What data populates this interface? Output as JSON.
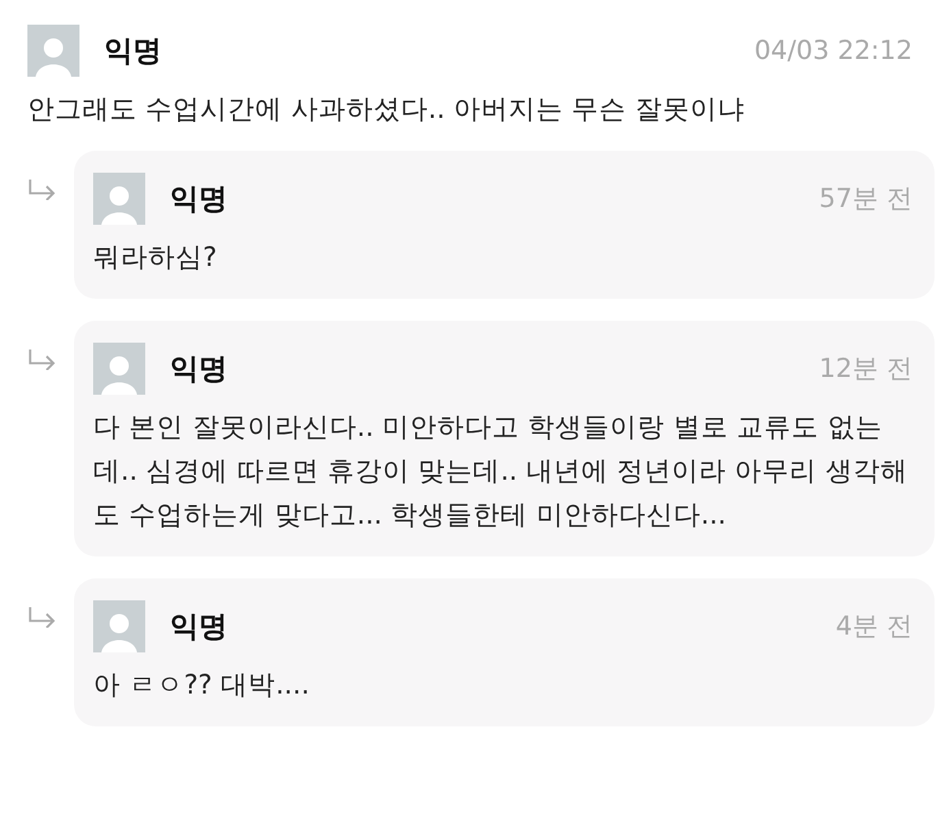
{
  "comment": {
    "author": "익명",
    "time": "04/03 22:12",
    "text": "안그래도 수업시간에 사과하셨다.. 아버지는 무슨 잘못이냐"
  },
  "replies": [
    {
      "author": "익명",
      "time": "57분 전",
      "text": "뭐라하심?"
    },
    {
      "author": "익명",
      "time": "12분 전",
      "text": "다 본인 잘못이라신다.. 미안하다고 학생들이랑 별로 교류도 없는데.. 심경에 따르면 휴강이 맞는데.. 내년에 정년이라 아무리 생각해도 수업하는게 맞다고... 학생들한테 미안하다신다..."
    },
    {
      "author": "익명",
      "time": "4분 전",
      "text": "아 ㄹㅇ?? 대박...."
    }
  ]
}
